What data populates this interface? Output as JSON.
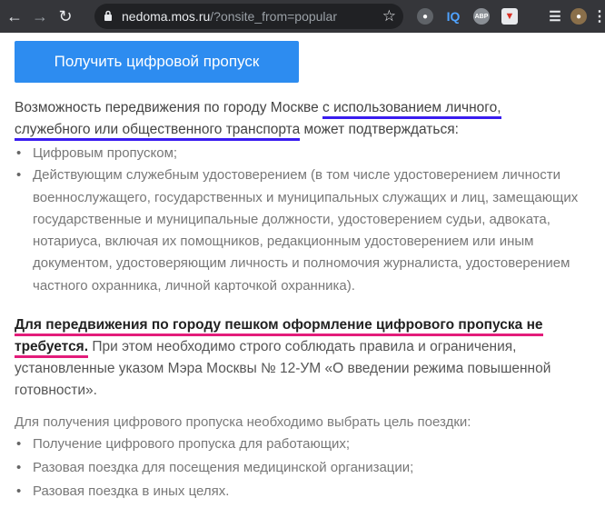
{
  "browser": {
    "url_host": "nedoma.mos.ru",
    "url_rest": "/?onsite_from=popular",
    "extensions": [
      "IQ",
      "ABP"
    ]
  },
  "page": {
    "cta_label": "Получить цифровой пропуск",
    "intro_before": "Возможность передвижения по городу Москве ",
    "intro_hl1": "с использованием личного,",
    "intro_hl2": "служебного или общественного транспорта",
    "intro_after": " может подтверждаться:",
    "list1": [
      "Цифровым пропуском;",
      "Действующим служебным удостоверением (в том числе удостоверением личности военнослужащего, государственных и муниципальных служащих и лиц, замещающих государственные и муниципальные должности, удостоверением судьи, адвоката, нотариуса, включая их помощников, редакционным удостоверением или иным документом, удостоверяющим личность и полномочия журналиста, удостоверением частного охранника, личной карточкой охранника)."
    ],
    "walk_hl1": "Для передвижения по городу пешком оформление цифрового пропуска не",
    "walk_hl2": "требуется.",
    "walk_rest": " При этом необходимо строго соблюдать правила и ограничения, установленные указом Мэра Москвы № 12-УМ «О введении режима повышенной готовности».",
    "purpose_intro": "Для получения цифрового пропуска необходимо выбрать цель поездки:",
    "list2": [
      "Получение цифрового пропуска для работающих;",
      "Разовая поездка для посещения медицинской организации;",
      "Разовая поездка в иных целях."
    ]
  }
}
